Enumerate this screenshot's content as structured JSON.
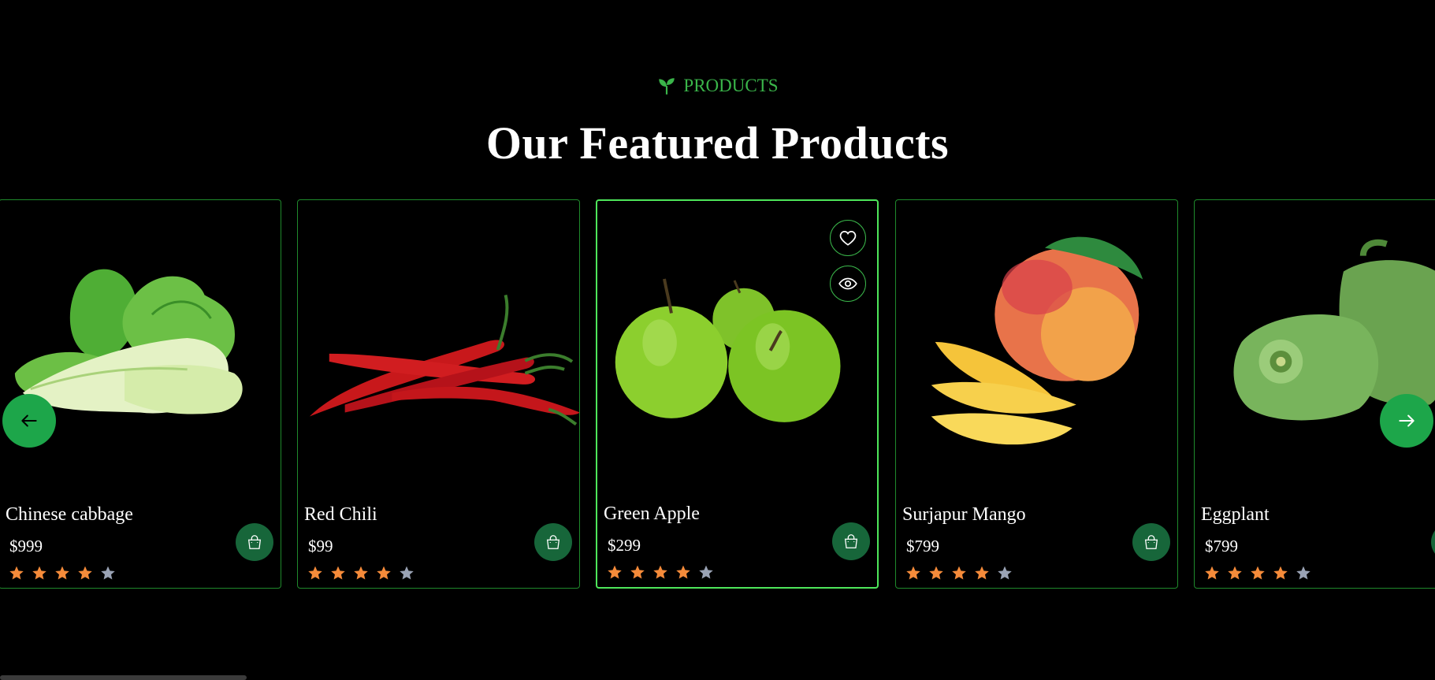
{
  "section": {
    "eyebrow_icon": "leaf-sprout-icon",
    "eyebrow": "PRODUCTS",
    "title": "Our Featured Products"
  },
  "colors": {
    "accent": "#3ab54a",
    "card_border": "#1f8a2c",
    "active_border": "#4ee65a",
    "cart_button": "#17663a",
    "star_filled": "#f58b3a",
    "star_empty": "#9aa3b5"
  },
  "products": [
    {
      "name": "Chinese cabbage",
      "price": "$999",
      "rating": 4,
      "image": "chinese-cabbage-image"
    },
    {
      "name": "Red Chili",
      "price": "$99",
      "rating": 4,
      "image": "red-chili-image"
    },
    {
      "name": "Green Apple",
      "price": "$299",
      "rating": 4,
      "image": "green-apple-image",
      "active": true
    },
    {
      "name": "Surjapur Mango",
      "price": "$799",
      "rating": 4,
      "image": "mango-image"
    },
    {
      "name": "Eggplant",
      "price": "$799",
      "rating": 4,
      "image": "green-pepper-image"
    }
  ],
  "carousel": {
    "prev_icon": "arrow-left-icon",
    "next_icon": "arrow-right-icon",
    "wishlist_icon": "heart-icon",
    "quick_view_icon": "eye-icon",
    "cart_icon": "shopping-bag-icon"
  }
}
